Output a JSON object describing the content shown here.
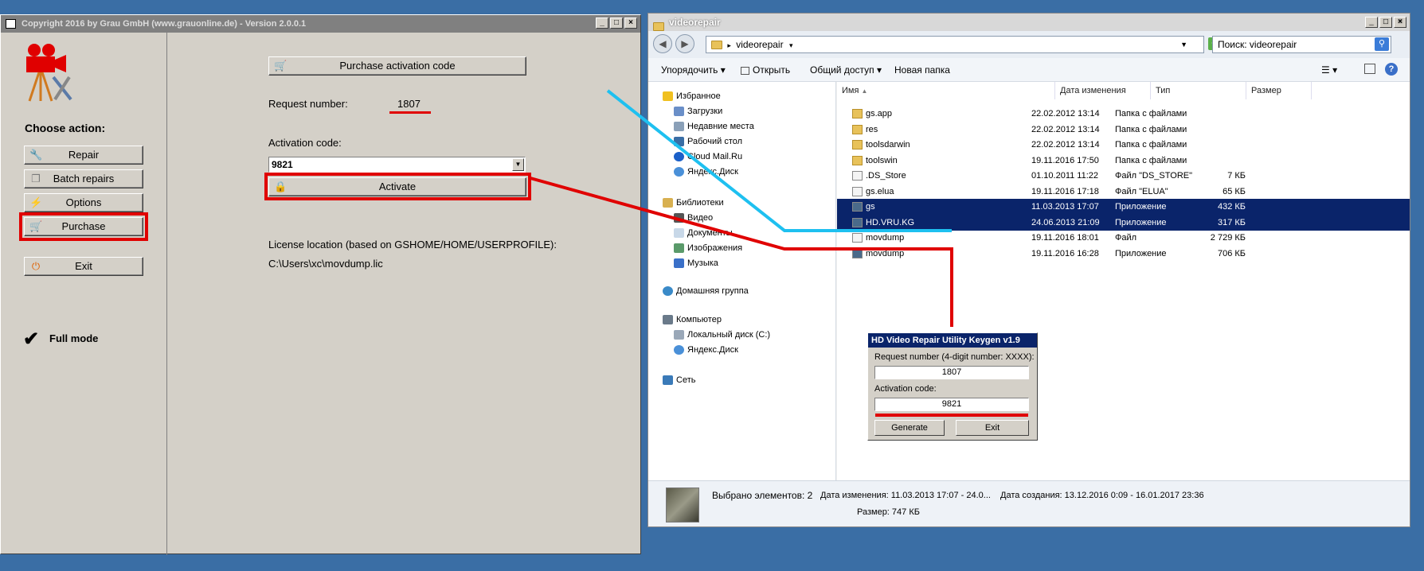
{
  "app": {
    "title": "Copyright 2016 by Grau GmbH (www.grauonline.de) - Version 2.0.0.1",
    "choose_action": "Choose action:",
    "buttons": {
      "repair": "Repair",
      "batch": "Batch repairs",
      "options": "Options",
      "purchase": "Purchase",
      "exit": "Exit"
    },
    "full_mode": "Full mode",
    "purchase_code_button": "Purchase activation code",
    "request_label": "Request number:",
    "request_number": "1807",
    "activation_label": "Activation code:",
    "activation_value": "9821",
    "activate_button": "Activate",
    "license_label": "License location (based on GSHOME/HOME/USERPROFILE):",
    "license_path": "C:\\Users\\xc\\movdump.lic"
  },
  "explorer": {
    "title": "videorepair",
    "address": "videorepair",
    "search_placeholder": "Поиск: videorepair",
    "toolbar": {
      "organize": "Упорядочить",
      "open": "Открыть",
      "share": "Общий доступ",
      "new_folder": "Новая папка"
    },
    "nav": {
      "favorites": "Избранное",
      "fav_items": [
        "Загрузки",
        "Недавние места",
        "Рабочий стол",
        "Cloud Mail.Ru",
        "Яндекс.Диск"
      ],
      "libraries": "Библиотеки",
      "lib_items": [
        "Видео",
        "Документы",
        "Изображения",
        "Музыка"
      ],
      "homegroup": "Домашняя группа",
      "computer": "Компьютер",
      "comp_items": [
        "Локальный диск (C:)",
        "Яндекс.Диск"
      ],
      "network": "Сеть"
    },
    "columns": [
      "Имя",
      "Дата изменения",
      "Тип",
      "Размер"
    ],
    "files": [
      {
        "name": "gs.app",
        "date": "22.02.2012 13:14",
        "type": "Папка с файлами",
        "size": "",
        "icon": "folder-icon",
        "selected": false
      },
      {
        "name": "res",
        "date": "22.02.2012 13:14",
        "type": "Папка с файлами",
        "size": "",
        "icon": "folder-icon",
        "selected": false
      },
      {
        "name": "toolsdarwin",
        "date": "22.02.2012 13:14",
        "type": "Папка с файлами",
        "size": "",
        "icon": "folder-icon",
        "selected": false
      },
      {
        "name": "toolswin",
        "date": "19.11.2016 17:50",
        "type": "Папка с файлами",
        "size": "",
        "icon": "folder-icon",
        "selected": false
      },
      {
        "name": ".DS_Store",
        "date": "01.10.2011 11:22",
        "type": "Файл \"DS_STORE\"",
        "size": "7 КБ",
        "icon": "file-icon",
        "selected": false
      },
      {
        "name": "gs.elua",
        "date": "19.11.2016 17:18",
        "type": "Файл \"ELUA\"",
        "size": "65 КБ",
        "icon": "file-icon",
        "selected": false
      },
      {
        "name": "gs",
        "date": "11.03.2013 17:07",
        "type": "Приложение",
        "size": "432 КБ",
        "icon": "app-icon",
        "selected": true
      },
      {
        "name": "HD.VRU.KG",
        "date": "24.06.2013 21:09",
        "type": "Приложение",
        "size": "317 КБ",
        "icon": "app-icon",
        "selected": true
      },
      {
        "name": "movdump",
        "date": "19.11.2016 18:01",
        "type": "Файл",
        "size": "2 729 КБ",
        "icon": "file-icon",
        "selected": false
      },
      {
        "name": "movdump",
        "date": "19.11.2016 16:28",
        "type": "Приложение",
        "size": "706 КБ",
        "icon": "app-icon",
        "selected": false
      }
    ],
    "details": {
      "selected": "Выбрано элементов: 2",
      "modified": "Дата изменения: 11.03.2013 17:07 - 24.0...",
      "created": "Дата создания: 13.12.2016 0:09 - 16.01.2017 23:36",
      "size": "Размер: 747 КБ"
    }
  },
  "keygen": {
    "title": "HD Video Repair Utility Keygen v1.9",
    "request_label": "Request number (4-digit number: XXXX):",
    "request_value": "1807",
    "activation_label": "Activation code:",
    "activation_value": "9821",
    "generate": "Generate",
    "exit": "Exit"
  },
  "colors": {
    "desktop": "#3a6ea5",
    "highlight_red": "#e00000",
    "annotation_blue": "#1ec0f0",
    "selection": "#0a246a"
  }
}
